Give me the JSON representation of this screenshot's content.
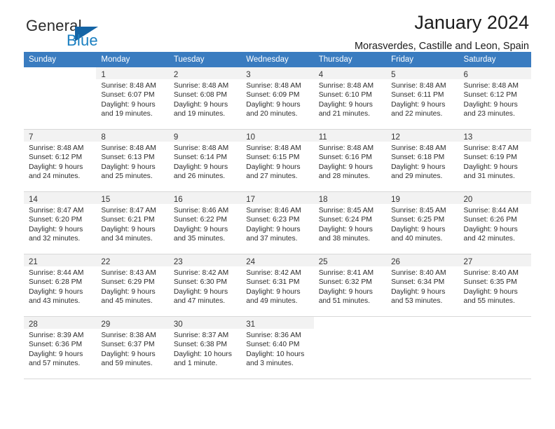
{
  "brand": {
    "general": "General",
    "blue": "Blue",
    "mark_icon": "triangle-logo-icon",
    "accent_color": "#1464a5"
  },
  "header": {
    "title": "January 2024",
    "subtitle": "Morasverdes, Castille and Leon, Spain"
  },
  "theme": {
    "header_row_bg": "#3a7cc0",
    "daynum_bg": "#f2f2f2",
    "grid_line": "#d8d8d8",
    "text": "#2c2c2c"
  },
  "columns": [
    "Sunday",
    "Monday",
    "Tuesday",
    "Wednesday",
    "Thursday",
    "Friday",
    "Saturday"
  ],
  "weeks": [
    [
      null,
      {
        "day": "1",
        "sunrise": "Sunrise: 8:48 AM",
        "sunset": "Sunset: 6:07 PM",
        "daylight1": "Daylight: 9 hours",
        "daylight2": "and 19 minutes."
      },
      {
        "day": "2",
        "sunrise": "Sunrise: 8:48 AM",
        "sunset": "Sunset: 6:08 PM",
        "daylight1": "Daylight: 9 hours",
        "daylight2": "and 19 minutes."
      },
      {
        "day": "3",
        "sunrise": "Sunrise: 8:48 AM",
        "sunset": "Sunset: 6:09 PM",
        "daylight1": "Daylight: 9 hours",
        "daylight2": "and 20 minutes."
      },
      {
        "day": "4",
        "sunrise": "Sunrise: 8:48 AM",
        "sunset": "Sunset: 6:10 PM",
        "daylight1": "Daylight: 9 hours",
        "daylight2": "and 21 minutes."
      },
      {
        "day": "5",
        "sunrise": "Sunrise: 8:48 AM",
        "sunset": "Sunset: 6:11 PM",
        "daylight1": "Daylight: 9 hours",
        "daylight2": "and 22 minutes."
      },
      {
        "day": "6",
        "sunrise": "Sunrise: 8:48 AM",
        "sunset": "Sunset: 6:12 PM",
        "daylight1": "Daylight: 9 hours",
        "daylight2": "and 23 minutes."
      }
    ],
    [
      {
        "day": "7",
        "sunrise": "Sunrise: 8:48 AM",
        "sunset": "Sunset: 6:12 PM",
        "daylight1": "Daylight: 9 hours",
        "daylight2": "and 24 minutes."
      },
      {
        "day": "8",
        "sunrise": "Sunrise: 8:48 AM",
        "sunset": "Sunset: 6:13 PM",
        "daylight1": "Daylight: 9 hours",
        "daylight2": "and 25 minutes."
      },
      {
        "day": "9",
        "sunrise": "Sunrise: 8:48 AM",
        "sunset": "Sunset: 6:14 PM",
        "daylight1": "Daylight: 9 hours",
        "daylight2": "and 26 minutes."
      },
      {
        "day": "10",
        "sunrise": "Sunrise: 8:48 AM",
        "sunset": "Sunset: 6:15 PM",
        "daylight1": "Daylight: 9 hours",
        "daylight2": "and 27 minutes."
      },
      {
        "day": "11",
        "sunrise": "Sunrise: 8:48 AM",
        "sunset": "Sunset: 6:16 PM",
        "daylight1": "Daylight: 9 hours",
        "daylight2": "and 28 minutes."
      },
      {
        "day": "12",
        "sunrise": "Sunrise: 8:48 AM",
        "sunset": "Sunset: 6:18 PM",
        "daylight1": "Daylight: 9 hours",
        "daylight2": "and 29 minutes."
      },
      {
        "day": "13",
        "sunrise": "Sunrise: 8:47 AM",
        "sunset": "Sunset: 6:19 PM",
        "daylight1": "Daylight: 9 hours",
        "daylight2": "and 31 minutes."
      }
    ],
    [
      {
        "day": "14",
        "sunrise": "Sunrise: 8:47 AM",
        "sunset": "Sunset: 6:20 PM",
        "daylight1": "Daylight: 9 hours",
        "daylight2": "and 32 minutes."
      },
      {
        "day": "15",
        "sunrise": "Sunrise: 8:47 AM",
        "sunset": "Sunset: 6:21 PM",
        "daylight1": "Daylight: 9 hours",
        "daylight2": "and 34 minutes."
      },
      {
        "day": "16",
        "sunrise": "Sunrise: 8:46 AM",
        "sunset": "Sunset: 6:22 PM",
        "daylight1": "Daylight: 9 hours",
        "daylight2": "and 35 minutes."
      },
      {
        "day": "17",
        "sunrise": "Sunrise: 8:46 AM",
        "sunset": "Sunset: 6:23 PM",
        "daylight1": "Daylight: 9 hours",
        "daylight2": "and 37 minutes."
      },
      {
        "day": "18",
        "sunrise": "Sunrise: 8:45 AM",
        "sunset": "Sunset: 6:24 PM",
        "daylight1": "Daylight: 9 hours",
        "daylight2": "and 38 minutes."
      },
      {
        "day": "19",
        "sunrise": "Sunrise: 8:45 AM",
        "sunset": "Sunset: 6:25 PM",
        "daylight1": "Daylight: 9 hours",
        "daylight2": "and 40 minutes."
      },
      {
        "day": "20",
        "sunrise": "Sunrise: 8:44 AM",
        "sunset": "Sunset: 6:26 PM",
        "daylight1": "Daylight: 9 hours",
        "daylight2": "and 42 minutes."
      }
    ],
    [
      {
        "day": "21",
        "sunrise": "Sunrise: 8:44 AM",
        "sunset": "Sunset: 6:28 PM",
        "daylight1": "Daylight: 9 hours",
        "daylight2": "and 43 minutes."
      },
      {
        "day": "22",
        "sunrise": "Sunrise: 8:43 AM",
        "sunset": "Sunset: 6:29 PM",
        "daylight1": "Daylight: 9 hours",
        "daylight2": "and 45 minutes."
      },
      {
        "day": "23",
        "sunrise": "Sunrise: 8:42 AM",
        "sunset": "Sunset: 6:30 PM",
        "daylight1": "Daylight: 9 hours",
        "daylight2": "and 47 minutes."
      },
      {
        "day": "24",
        "sunrise": "Sunrise: 8:42 AM",
        "sunset": "Sunset: 6:31 PM",
        "daylight1": "Daylight: 9 hours",
        "daylight2": "and 49 minutes."
      },
      {
        "day": "25",
        "sunrise": "Sunrise: 8:41 AM",
        "sunset": "Sunset: 6:32 PM",
        "daylight1": "Daylight: 9 hours",
        "daylight2": "and 51 minutes."
      },
      {
        "day": "26",
        "sunrise": "Sunrise: 8:40 AM",
        "sunset": "Sunset: 6:34 PM",
        "daylight1": "Daylight: 9 hours",
        "daylight2": "and 53 minutes."
      },
      {
        "day": "27",
        "sunrise": "Sunrise: 8:40 AM",
        "sunset": "Sunset: 6:35 PM",
        "daylight1": "Daylight: 9 hours",
        "daylight2": "and 55 minutes."
      }
    ],
    [
      {
        "day": "28",
        "sunrise": "Sunrise: 8:39 AM",
        "sunset": "Sunset: 6:36 PM",
        "daylight1": "Daylight: 9 hours",
        "daylight2": "and 57 minutes."
      },
      {
        "day": "29",
        "sunrise": "Sunrise: 8:38 AM",
        "sunset": "Sunset: 6:37 PM",
        "daylight1": "Daylight: 9 hours",
        "daylight2": "and 59 minutes."
      },
      {
        "day": "30",
        "sunrise": "Sunrise: 8:37 AM",
        "sunset": "Sunset: 6:38 PM",
        "daylight1": "Daylight: 10 hours",
        "daylight2": "and 1 minute."
      },
      {
        "day": "31",
        "sunrise": "Sunrise: 8:36 AM",
        "sunset": "Sunset: 6:40 PM",
        "daylight1": "Daylight: 10 hours",
        "daylight2": "and 3 minutes."
      },
      null,
      null,
      null
    ]
  ]
}
